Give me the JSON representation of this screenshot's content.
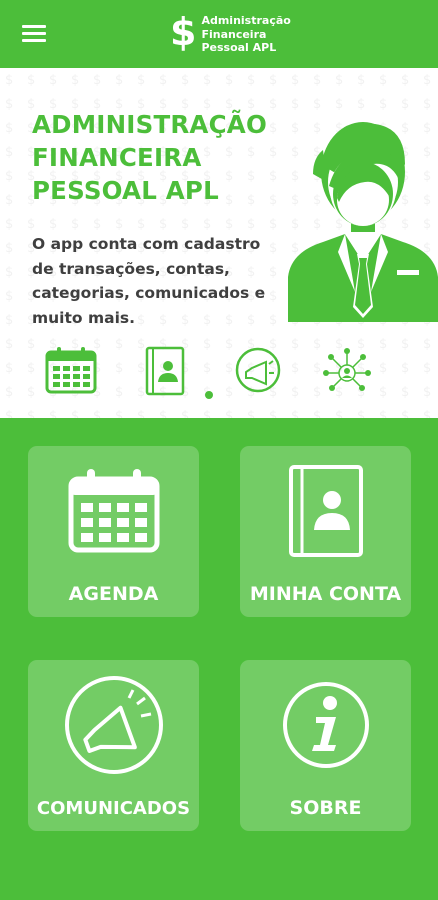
{
  "app": {
    "logo_symbol": "$",
    "logo_lines": [
      "Administração",
      "Financeira",
      "Pessoal APL"
    ],
    "menu_icon": "hamburger-menu-icon"
  },
  "hero": {
    "title_lines": [
      "ADMINISTRAÇÃO",
      "FINANCEIRA",
      "PESSOAL APL"
    ],
    "description": "O app conta com cadastro de transações, contas, categorias, comunicados e muito mais.",
    "icons": [
      "calendar-icon",
      "contact-book-icon",
      "megaphone-icon",
      "network-icon"
    ],
    "illustration": "businessman-icon",
    "pager_active": 1
  },
  "menu": {
    "agenda": {
      "label": "AGENDA",
      "icon": "calendar-icon"
    },
    "conta": {
      "label": "MINHA CONTA",
      "icon": "contact-book-icon"
    },
    "comunicados": {
      "label": "COMUNICADOS",
      "icon": "megaphone-icon"
    },
    "sobre": {
      "label": "SOBRE",
      "icon": "info-icon"
    }
  },
  "colors": {
    "brand_green": "#4cbe3a",
    "text_dark": "#3f3f3f",
    "white": "#ffffff"
  }
}
